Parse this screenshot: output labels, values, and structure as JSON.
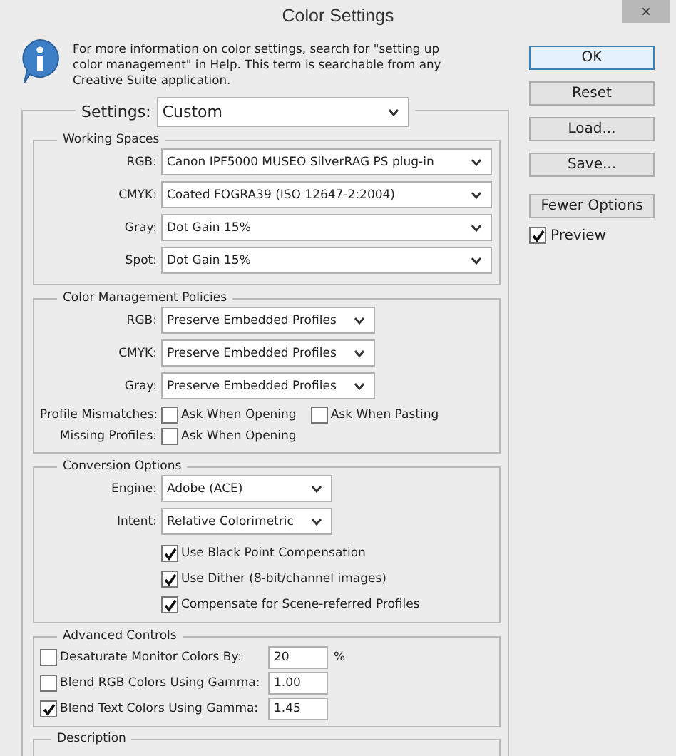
{
  "window": {
    "title": "Color Settings",
    "close": "×"
  },
  "info": "For more information on color settings, search for \"setting up color management\" in Help. This term is searchable from any Creative Suite application.",
  "settings": {
    "label": "Settings:",
    "value": "Custom"
  },
  "working_spaces": {
    "title": "Working Spaces",
    "rows": [
      {
        "label": "RGB:",
        "value": "Canon IPF5000 MUSEO SilverRAG PS plug-in"
      },
      {
        "label": "CMYK:",
        "value": "Coated FOGRA39 (ISO 12647-2:2004)"
      },
      {
        "label": "Gray:",
        "value": "Dot Gain 15%"
      },
      {
        "label": "Spot:",
        "value": "Dot Gain 15%"
      }
    ]
  },
  "policies": {
    "title": "Color Management Policies",
    "rows": [
      {
        "label": "RGB:",
        "value": "Preserve Embedded Profiles"
      },
      {
        "label": "CMYK:",
        "value": "Preserve Embedded Profiles"
      },
      {
        "label": "Gray:",
        "value": "Preserve Embedded Profiles"
      }
    ],
    "checks": [
      {
        "label": "Profile Mismatches:",
        "options": [
          {
            "label": "Ask When Opening",
            "checked": false
          },
          {
            "label": "Ask When Pasting",
            "checked": false
          }
        ]
      },
      {
        "label": "Missing Profiles:",
        "options": [
          {
            "label": "Ask When Opening",
            "checked": false
          }
        ]
      }
    ]
  },
  "conversion": {
    "title": "Conversion Options",
    "rows": [
      {
        "label": "Engine:",
        "value": "Adobe (ACE)"
      },
      {
        "label": "Intent:",
        "value": "Relative Colorimetric"
      }
    ],
    "options": [
      {
        "label": "Use Black Point Compensation",
        "checked": true
      },
      {
        "label": "Use Dither (8-bit/channel images)",
        "checked": true
      },
      {
        "label": "Compensate for Scene-referred Profiles",
        "checked": true
      }
    ]
  },
  "advanced": {
    "title": "Advanced Controls",
    "rows": [
      {
        "label": "Desaturate Monitor Colors By:",
        "checked": false,
        "value": "20",
        "unit": "%"
      },
      {
        "label": "Blend RGB Colors Using Gamma:",
        "checked": false,
        "value": "1.00"
      },
      {
        "label": "Blend Text Colors Using Gamma:",
        "checked": true,
        "value": "1.45"
      }
    ]
  },
  "description": {
    "title": "Description"
  },
  "buttons": [
    {
      "label": "OK",
      "default": true
    },
    {
      "label": "Reset",
      "default": false
    },
    {
      "label": "Load...",
      "default": false
    },
    {
      "label": "Save...",
      "default": false
    },
    {
      "label": "Fewer Options",
      "default": false
    }
  ],
  "preview": {
    "label": "Preview",
    "checked": true
  }
}
